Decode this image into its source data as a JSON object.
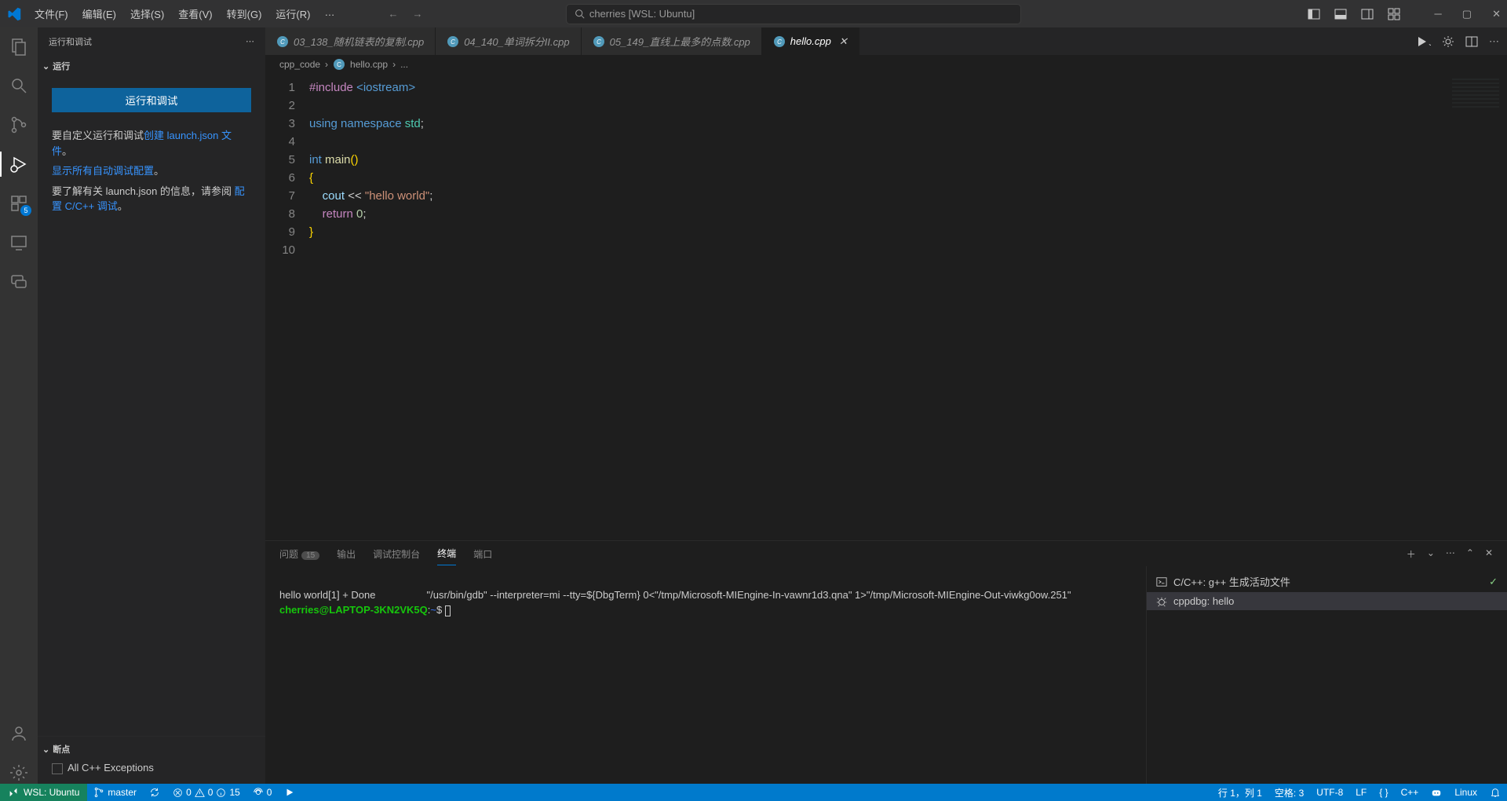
{
  "title": {
    "search": "cherries [WSL: Ubuntu]"
  },
  "menu": [
    "文件(F)",
    "编辑(E)",
    "选择(S)",
    "查看(V)",
    "转到(G)",
    "运行(R)",
    "…"
  ],
  "activity": {
    "ext_badge": "5"
  },
  "sidebar": {
    "title": "运行和调试",
    "run_section": "运行",
    "button": "运行和调试",
    "p1a": "要自定义运行和调试",
    "p1_link": "创建 launch.json 文件",
    "p1b": "。",
    "p2_link": "显示所有自动调试配置",
    "p2b": "。",
    "p3a": "要了解有关 launch.json 的信息，请参阅 ",
    "p3_link": "配置 C/C++ 调试",
    "p3b": "。",
    "breakpoints_title": "断点",
    "breakpoint_item": "All C++ Exceptions"
  },
  "tabs": [
    {
      "label": "03_138_随机链表的复制.cpp",
      "active": false
    },
    {
      "label": "04_140_单词拆分II.cpp",
      "active": false
    },
    {
      "label": "05_149_直线上最多的点数.cpp",
      "active": false
    },
    {
      "label": "hello.cpp",
      "active": true
    }
  ],
  "breadcrumb": {
    "root": "cpp_code",
    "file": "hello.cpp",
    "more": "..."
  },
  "code_lines": [
    "1",
    "2",
    "3",
    "4",
    "5",
    "6",
    "7",
    "8",
    "9",
    "10"
  ],
  "panel": {
    "tabs": {
      "problems": "问题",
      "problems_count": "15",
      "output": "输出",
      "debug": "调试控制台",
      "terminal": "终端",
      "ports": "端口"
    },
    "terminal_out1": "hello world[1] + Done                  \"/usr/bin/gdb\" --interpreter=mi --tty=${DbgTerm} 0<\"/tmp/Microsoft-MIEngine-In-vawnr1d3.qna\" 1>\"/tmp/Microsoft-MIEngine-Out-viwkg0ow.251\"",
    "prompt_user": "cherries@LAPTOP-3KN2VK5Q",
    "prompt_colon": ":",
    "prompt_path": "~",
    "prompt_dollar": "$ ",
    "side": [
      {
        "icon": "terminal",
        "label": "C/C++: g++ 生成活动文件",
        "check": true,
        "active": false
      },
      {
        "icon": "debug",
        "label": "cppdbg: hello",
        "check": false,
        "active": true
      }
    ]
  },
  "status": {
    "remote": "WSL: Ubuntu",
    "branch": "master",
    "sync": "",
    "errors": "0",
    "warnings": "0",
    "info": "15",
    "ports": "0",
    "cursor": "行 1，列 1",
    "spaces": "空格: 3",
    "encoding": "UTF-8",
    "eol": "LF",
    "lang": "C++",
    "os": "Linux",
    "braces": "{ }"
  }
}
